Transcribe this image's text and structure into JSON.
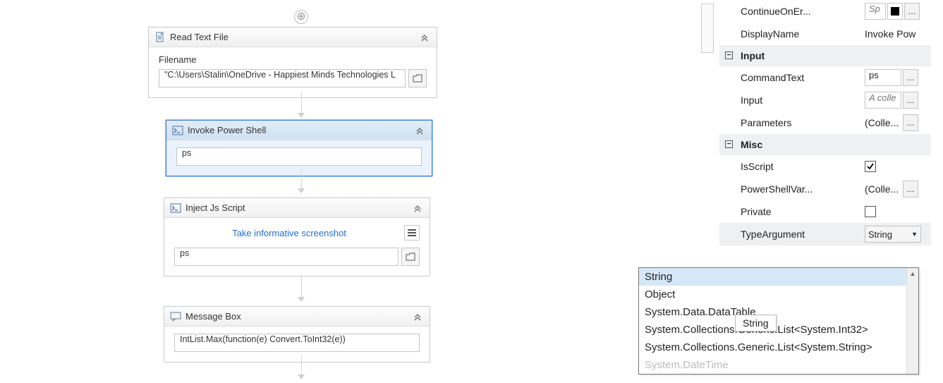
{
  "canvas": {
    "activities": [
      {
        "id": "read",
        "title": "Read Text File",
        "filename_label": "Filename",
        "filename_value": "\"C:\\Users\\Stalin\\OneDrive - Happiest Minds Technologies L"
      },
      {
        "id": "invoke",
        "title": "Invoke Power Shell",
        "command_value": "ps"
      },
      {
        "id": "inject",
        "title": "Inject Js Script",
        "link_text": "Take informative screenshot",
        "input_value": "ps"
      },
      {
        "id": "msgbox",
        "title": "Message Box",
        "input_value": "IntList.Max(function(e) Convert.ToInt32(e))"
      }
    ]
  },
  "properties": {
    "rows_before_input": [
      {
        "name": "ContinueOnEr...",
        "value": "Sp",
        "italic": true,
        "color_swatch": true,
        "dots": true
      },
      {
        "name": "DisplayName",
        "value": "Invoke Pow",
        "plain": true
      }
    ],
    "cat_input": "Input",
    "input_rows": [
      {
        "name": "CommandText",
        "value": "ps",
        "dots": true
      },
      {
        "name": "Input",
        "value": "A colle",
        "italic": true,
        "dots": true
      },
      {
        "name": "Parameters",
        "value": "(Colle...",
        "plain": true,
        "dots": true
      }
    ],
    "cat_misc": "Misc",
    "misc_rows": [
      {
        "name": "IsScript",
        "checkbox": true,
        "checked": true
      },
      {
        "name": "PowerShellVar...",
        "value": "(Colle...",
        "plain": true,
        "dots": true
      },
      {
        "name": "Private",
        "checkbox": true,
        "checked": false
      },
      {
        "name": "TypeArgument",
        "combo": "String"
      }
    ]
  },
  "dropdown": {
    "options": [
      "String",
      "Object",
      "System.Data.DataTable",
      "System.Collections.Generic.List<System.Int32>",
      "System.Collections.Generic.List<System.String>",
      "System.DateTime"
    ],
    "tooltip": "String"
  }
}
